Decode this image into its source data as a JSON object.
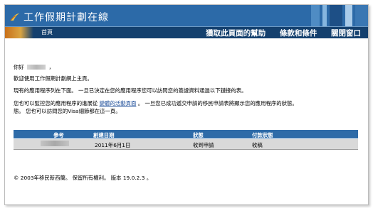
{
  "banner": {
    "title": "工作假期計劃在線"
  },
  "nav": {
    "home_label": "首頁",
    "help_label": "獲取此頁面的幫助",
    "terms_label": "條款和條件",
    "close_label": "關閉窗口"
  },
  "content": {
    "greeting_prefix": "你好",
    "greeting_suffix": "，",
    "welcome": "歡迎使用工作假期計劃網上主頁。",
    "para1": "現有的應用程序列在下面。 一旦已決定在您的應用程序您可以訪問您的簽證資料通過以下鏈接的表。",
    "para2_before": "您也可以監控您的應用程序的進展從",
    "para2_link": "變體的活動頁面",
    "para2_after": "。 一旦您已成功遞交申請的移民申請表將顯示您的應用程序的狀態。",
    "para3": "態。 您也可以訪問您的Visa細節都在這一頁。"
  },
  "table": {
    "headers": [
      "參考",
      "創建日期",
      "狀態",
      "付款狀態"
    ],
    "rows": [
      {
        "reference": "",
        "created": "2011年6月1日",
        "status": "收到申請",
        "payment": "收稿"
      }
    ]
  },
  "footer": {
    "text": "© 2003年移民新西蘭。 保留所有權利。 版本 19.0.2.3 。"
  },
  "colors": {
    "banner": "#2c6aa8",
    "navbar": "#14406e",
    "table_header": "#2e6ba8",
    "table_row": "#d9d9d9",
    "link": "#1f4f9a"
  }
}
